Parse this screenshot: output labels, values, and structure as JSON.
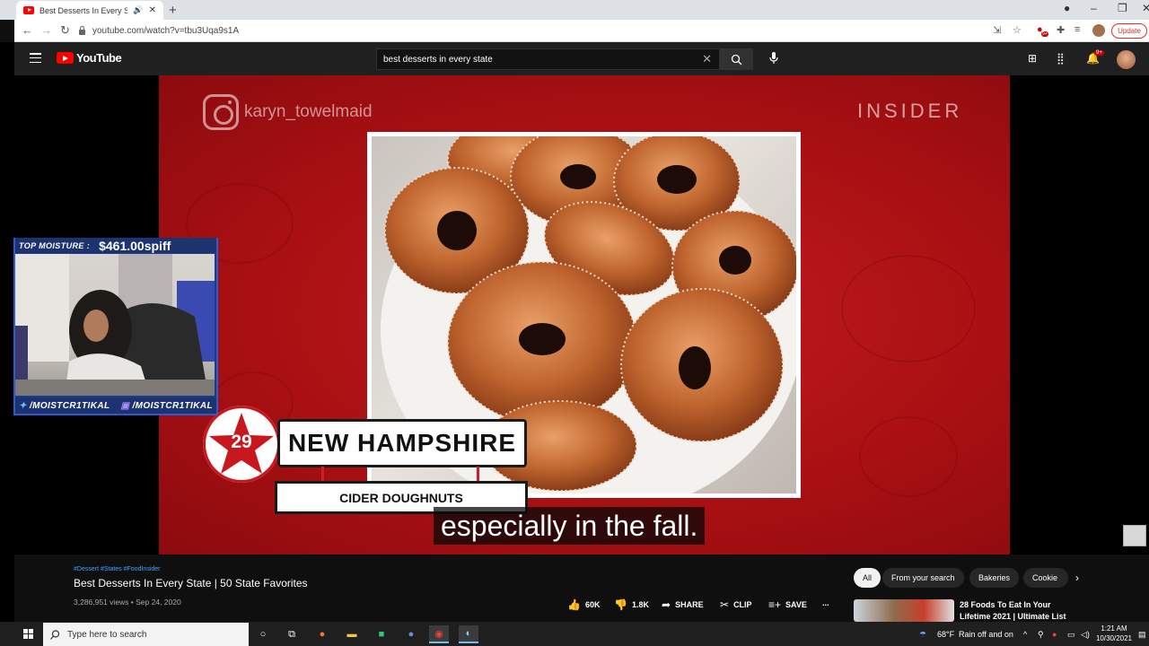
{
  "browser": {
    "tab_title": "Best Desserts In Every State",
    "new_tab": "+",
    "url": "youtube.com/watch?v=tbu3Uqa9s1A",
    "update_label": "Update",
    "ext_badge": "9+"
  },
  "youtube": {
    "logo_text": "YouTube",
    "search_query": "best desserts in every state",
    "notification_count": "9+"
  },
  "video": {
    "instagram_handle": "karyn_towelmaid",
    "brand": "INSIDER",
    "rank": "29",
    "state": "NEW HAMPSHIRE",
    "dessert": "CIDER DOUGHNUTS",
    "caption": "especially in the fall.",
    "hashtags": "#Dessert #States #FoodInsider",
    "title": "Best Desserts In Every State | 50 State Favorites",
    "meta": "3,286,951 views • Sep 24, 2020",
    "actions": {
      "likes": "60K",
      "dislikes": "1.8K",
      "share": "SHARE",
      "clip": "CLIP",
      "save": "SAVE",
      "more": "..."
    }
  },
  "stream_overlay": {
    "top_label": "TOP MOISTURE :",
    "amount": "$461.00spiff",
    "twitter": "/MOISTCR1TIKAL",
    "twitch": "/MOISTCR1TIKAL"
  },
  "chips": [
    "All",
    "From your search",
    "Bakeries",
    "Cookie"
  ],
  "recommendation": {
    "title": "28 Foods To Eat In Your Lifetime 2021 | Ultimate List"
  },
  "taskbar": {
    "search_placeholder": "Type here to search",
    "weather_temp": "68°F",
    "weather_text": "Rain off and on",
    "time": "1:21 AM",
    "date": "10/30/2021"
  },
  "colors": {
    "youtube_red": "#ff0000",
    "video_background": "#aa1013",
    "link_blue": "#3ea6ff",
    "overlay_blue": "#1d3370"
  }
}
